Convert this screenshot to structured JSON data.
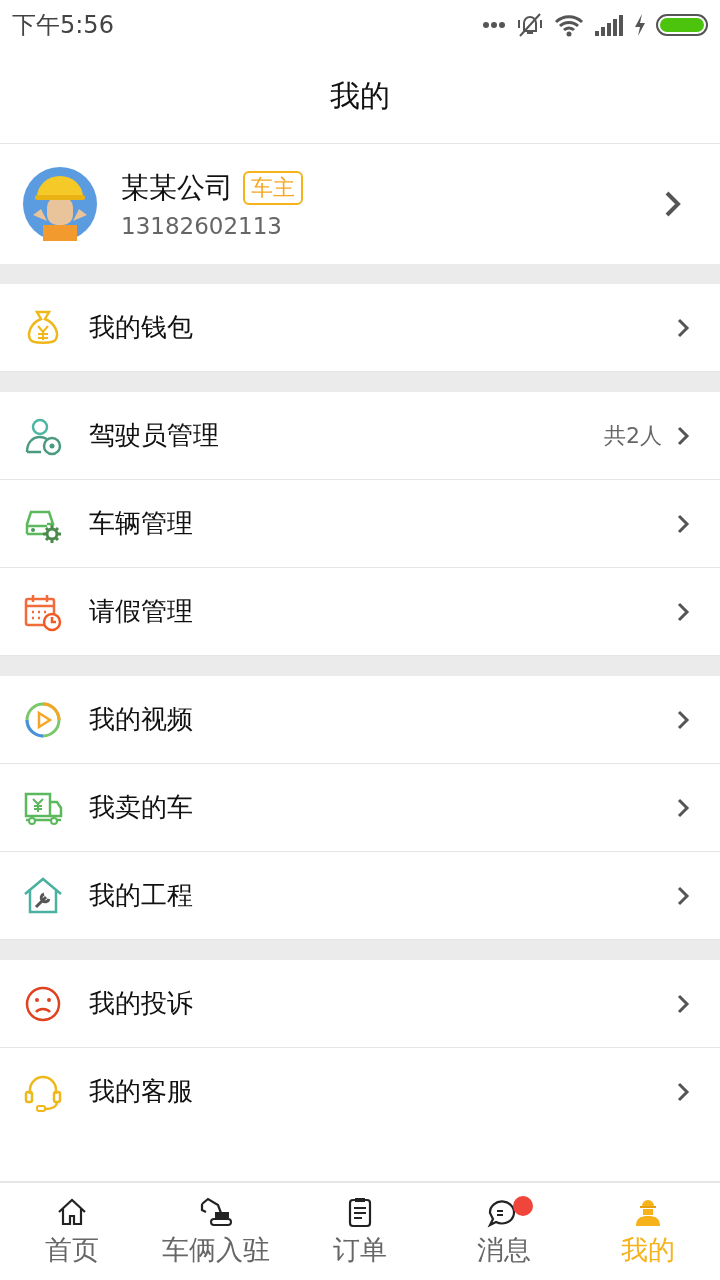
{
  "status_bar": {
    "time": "下午5:56"
  },
  "header": {
    "title": "我的"
  },
  "profile": {
    "name": "某某公司",
    "role_tag": "车主",
    "phone": "13182602113"
  },
  "sections": [
    {
      "items": [
        {
          "label": "我的钱包"
        }
      ]
    },
    {
      "items": [
        {
          "label": "驾驶员管理",
          "value": "共2人"
        },
        {
          "label": "车辆管理"
        },
        {
          "label": "请假管理"
        }
      ]
    },
    {
      "items": [
        {
          "label": "我的视频"
        },
        {
          "label": "我卖的车"
        },
        {
          "label": "我的工程"
        }
      ]
    },
    {
      "items": [
        {
          "label": "我的投诉"
        },
        {
          "label": "我的客服"
        }
      ]
    }
  ],
  "tab_bar": [
    {
      "label": "首页",
      "selected": false,
      "badge": false
    },
    {
      "label": "车俩入驻",
      "selected": false,
      "badge": false
    },
    {
      "label": "订单",
      "selected": false,
      "badge": false
    },
    {
      "label": "消息",
      "selected": false,
      "badge": true
    },
    {
      "label": "我的",
      "selected": true,
      "badge": false
    }
  ]
}
